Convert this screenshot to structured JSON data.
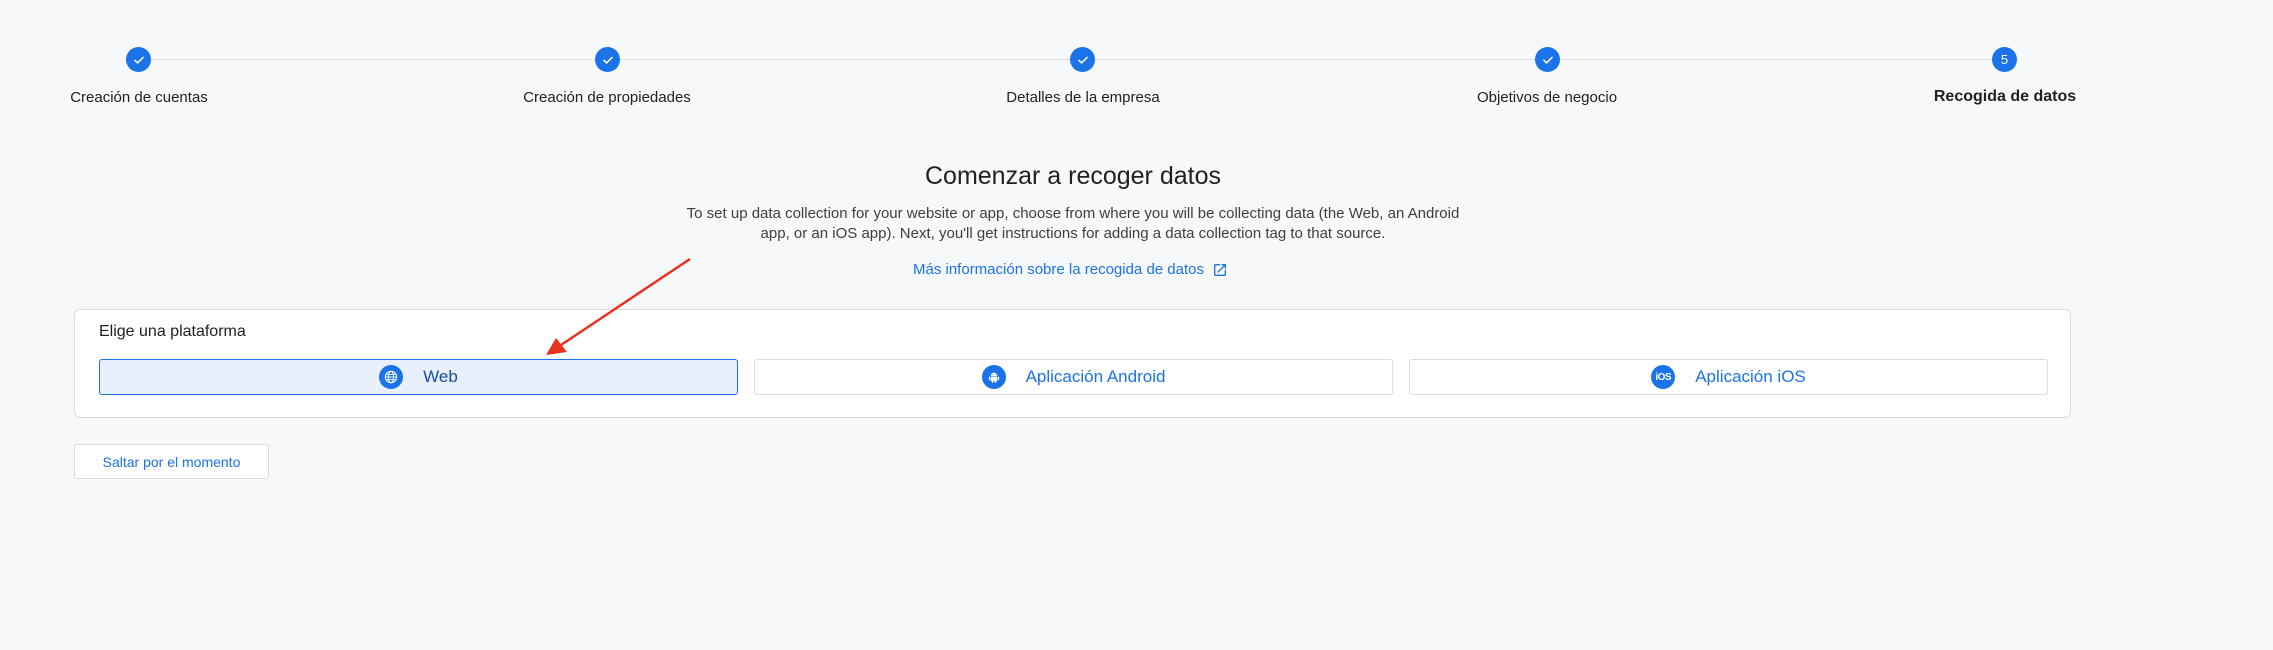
{
  "stepper": {
    "steps": [
      {
        "label": "Creación de cuentas",
        "state": "done"
      },
      {
        "label": "Creación de propiedades",
        "state": "done"
      },
      {
        "label": "Detalles de la empresa",
        "state": "done"
      },
      {
        "label": "Objetivos de negocio",
        "state": "done"
      },
      {
        "label": "Recogida de datos",
        "state": "current",
        "number": "5"
      }
    ],
    "accent": "#1a73e8"
  },
  "intro": {
    "title": "Comenzar a recoger datos",
    "description": "To set up data collection for your website or app, choose from where you will be collecting data (the Web, an Android app, or an iOS app). Next, you'll get instructions for adding a data collection tag to that source.",
    "learn_more": "Más información sobre la recogida de datos",
    "learn_more_icon": "open-in-new-icon"
  },
  "platform": {
    "title": "Elige una plataforma",
    "options": [
      {
        "label": "Web",
        "icon": "globe-icon",
        "selected": true
      },
      {
        "label": "Aplicación Android",
        "icon": "android-icon",
        "selected": false
      },
      {
        "label": "Aplicación iOS",
        "icon": "ios-icon",
        "icon_text": "iOS",
        "selected": false
      }
    ]
  },
  "skip_label": "Saltar por el momento",
  "annotation": {
    "color": "#e8321f",
    "icon": "arrow-annotation"
  }
}
